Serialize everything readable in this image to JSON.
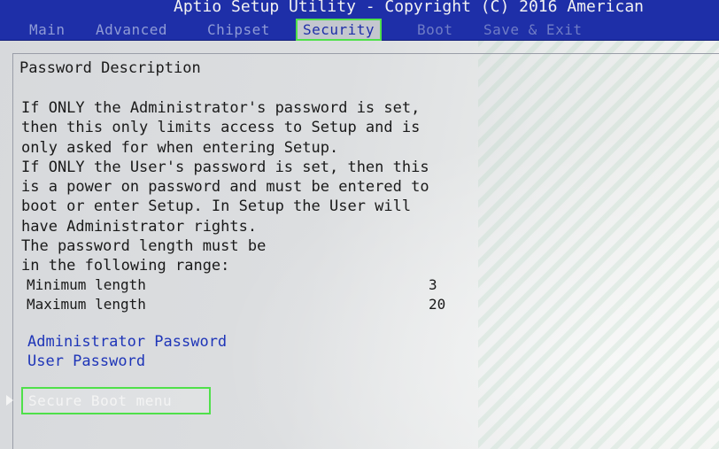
{
  "title_bar": {
    "text": "Aptio Setup Utility - Copyright (C) 2016 American"
  },
  "tabs": [
    {
      "label": "Main",
      "active": false
    },
    {
      "label": "Advanced",
      "active": false
    },
    {
      "label": "Chipset",
      "active": false
    },
    {
      "label": "Security",
      "active": true
    },
    {
      "label": "Boot",
      "active": false
    },
    {
      "label": "Save & Exit",
      "active": false
    }
  ],
  "panel": {
    "heading": "Password Description",
    "description_lines": [
      "If ONLY the Administrator's password is set,",
      "then this only limits access to Setup and is",
      "only asked for when entering Setup.",
      "If ONLY the User's password is set, then this",
      "is a power on password and must be entered to",
      "boot or enter Setup. In Setup the User will",
      "have Administrator rights.",
      "The password length must be",
      "in the following range:"
    ],
    "min_length": {
      "label": "Minimum length",
      "value": "3"
    },
    "max_length": {
      "label": "Maximum length",
      "value": "20"
    },
    "admin_password_label": "Administrator Password",
    "user_password_label": "User Password",
    "secure_boot_label": "Secure Boot menu"
  },
  "colors": {
    "bar_blue": "#1e2fa8",
    "link_blue": "#1e35b8",
    "highlight_green": "#4fe04a"
  }
}
